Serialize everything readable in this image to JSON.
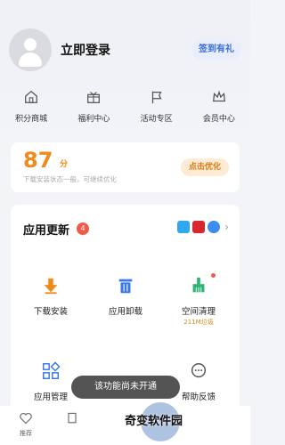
{
  "profile": {
    "login": "立即登录",
    "sign_in": "签到有礼"
  },
  "quick_links": [
    {
      "label": "积分商城",
      "icon": "home-icon"
    },
    {
      "label": "福利中心",
      "icon": "gift-icon"
    },
    {
      "label": "活动专区",
      "icon": "flag-icon"
    },
    {
      "label": "会员中心",
      "icon": "crown-icon"
    }
  ],
  "score": {
    "value": "87",
    "unit": "分",
    "desc": "下载安装状态一般，可继续优化",
    "button": "点击优化"
  },
  "updates": {
    "title": "应用更新",
    "badge": "4"
  },
  "tools": [
    {
      "label": "下载安装",
      "icon": "download-icon"
    },
    {
      "label": "应用卸载",
      "icon": "trash-icon"
    },
    {
      "label": "空间清理",
      "sub": "211M垃圾",
      "icon": "broom-icon"
    },
    {
      "label": "应用管理",
      "icon": "grid-icon"
    },
    {
      "label": "帮助反馈",
      "icon": "chat-icon"
    }
  ],
  "nav": [
    {
      "label": "推荐"
    }
  ],
  "toast": "该功能尚未开通",
  "watermark": "奇变软件园",
  "colors": {
    "accent": "#f08a1c",
    "primary": "#3a6fd8",
    "badge": "#f05a4a"
  }
}
